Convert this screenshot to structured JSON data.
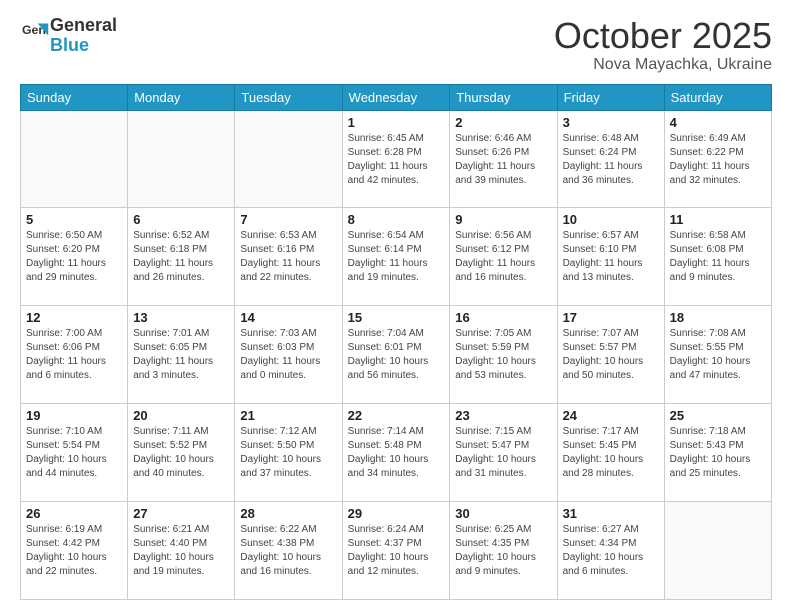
{
  "logo": {
    "line1": "General",
    "line2": "Blue"
  },
  "title": "October 2025",
  "location": "Nova Mayachka, Ukraine",
  "weekdays": [
    "Sunday",
    "Monday",
    "Tuesday",
    "Wednesday",
    "Thursday",
    "Friday",
    "Saturday"
  ],
  "weeks": [
    [
      {
        "day": "",
        "info": ""
      },
      {
        "day": "",
        "info": ""
      },
      {
        "day": "",
        "info": ""
      },
      {
        "day": "1",
        "info": "Sunrise: 6:45 AM\nSunset: 6:28 PM\nDaylight: 11 hours\nand 42 minutes."
      },
      {
        "day": "2",
        "info": "Sunrise: 6:46 AM\nSunset: 6:26 PM\nDaylight: 11 hours\nand 39 minutes."
      },
      {
        "day": "3",
        "info": "Sunrise: 6:48 AM\nSunset: 6:24 PM\nDaylight: 11 hours\nand 36 minutes."
      },
      {
        "day": "4",
        "info": "Sunrise: 6:49 AM\nSunset: 6:22 PM\nDaylight: 11 hours\nand 32 minutes."
      }
    ],
    [
      {
        "day": "5",
        "info": "Sunrise: 6:50 AM\nSunset: 6:20 PM\nDaylight: 11 hours\nand 29 minutes."
      },
      {
        "day": "6",
        "info": "Sunrise: 6:52 AM\nSunset: 6:18 PM\nDaylight: 11 hours\nand 26 minutes."
      },
      {
        "day": "7",
        "info": "Sunrise: 6:53 AM\nSunset: 6:16 PM\nDaylight: 11 hours\nand 22 minutes."
      },
      {
        "day": "8",
        "info": "Sunrise: 6:54 AM\nSunset: 6:14 PM\nDaylight: 11 hours\nand 19 minutes."
      },
      {
        "day": "9",
        "info": "Sunrise: 6:56 AM\nSunset: 6:12 PM\nDaylight: 11 hours\nand 16 minutes."
      },
      {
        "day": "10",
        "info": "Sunrise: 6:57 AM\nSunset: 6:10 PM\nDaylight: 11 hours\nand 13 minutes."
      },
      {
        "day": "11",
        "info": "Sunrise: 6:58 AM\nSunset: 6:08 PM\nDaylight: 11 hours\nand 9 minutes."
      }
    ],
    [
      {
        "day": "12",
        "info": "Sunrise: 7:00 AM\nSunset: 6:06 PM\nDaylight: 11 hours\nand 6 minutes."
      },
      {
        "day": "13",
        "info": "Sunrise: 7:01 AM\nSunset: 6:05 PM\nDaylight: 11 hours\nand 3 minutes."
      },
      {
        "day": "14",
        "info": "Sunrise: 7:03 AM\nSunset: 6:03 PM\nDaylight: 11 hours\nand 0 minutes."
      },
      {
        "day": "15",
        "info": "Sunrise: 7:04 AM\nSunset: 6:01 PM\nDaylight: 10 hours\nand 56 minutes."
      },
      {
        "day": "16",
        "info": "Sunrise: 7:05 AM\nSunset: 5:59 PM\nDaylight: 10 hours\nand 53 minutes."
      },
      {
        "day": "17",
        "info": "Sunrise: 7:07 AM\nSunset: 5:57 PM\nDaylight: 10 hours\nand 50 minutes."
      },
      {
        "day": "18",
        "info": "Sunrise: 7:08 AM\nSunset: 5:55 PM\nDaylight: 10 hours\nand 47 minutes."
      }
    ],
    [
      {
        "day": "19",
        "info": "Sunrise: 7:10 AM\nSunset: 5:54 PM\nDaylight: 10 hours\nand 44 minutes."
      },
      {
        "day": "20",
        "info": "Sunrise: 7:11 AM\nSunset: 5:52 PM\nDaylight: 10 hours\nand 40 minutes."
      },
      {
        "day": "21",
        "info": "Sunrise: 7:12 AM\nSunset: 5:50 PM\nDaylight: 10 hours\nand 37 minutes."
      },
      {
        "day": "22",
        "info": "Sunrise: 7:14 AM\nSunset: 5:48 PM\nDaylight: 10 hours\nand 34 minutes."
      },
      {
        "day": "23",
        "info": "Sunrise: 7:15 AM\nSunset: 5:47 PM\nDaylight: 10 hours\nand 31 minutes."
      },
      {
        "day": "24",
        "info": "Sunrise: 7:17 AM\nSunset: 5:45 PM\nDaylight: 10 hours\nand 28 minutes."
      },
      {
        "day": "25",
        "info": "Sunrise: 7:18 AM\nSunset: 5:43 PM\nDaylight: 10 hours\nand 25 minutes."
      }
    ],
    [
      {
        "day": "26",
        "info": "Sunrise: 6:19 AM\nSunset: 4:42 PM\nDaylight: 10 hours\nand 22 minutes."
      },
      {
        "day": "27",
        "info": "Sunrise: 6:21 AM\nSunset: 4:40 PM\nDaylight: 10 hours\nand 19 minutes."
      },
      {
        "day": "28",
        "info": "Sunrise: 6:22 AM\nSunset: 4:38 PM\nDaylight: 10 hours\nand 16 minutes."
      },
      {
        "day": "29",
        "info": "Sunrise: 6:24 AM\nSunset: 4:37 PM\nDaylight: 10 hours\nand 12 minutes."
      },
      {
        "day": "30",
        "info": "Sunrise: 6:25 AM\nSunset: 4:35 PM\nDaylight: 10 hours\nand 9 minutes."
      },
      {
        "day": "31",
        "info": "Sunrise: 6:27 AM\nSunset: 4:34 PM\nDaylight: 10 hours\nand 6 minutes."
      },
      {
        "day": "",
        "info": ""
      }
    ]
  ]
}
